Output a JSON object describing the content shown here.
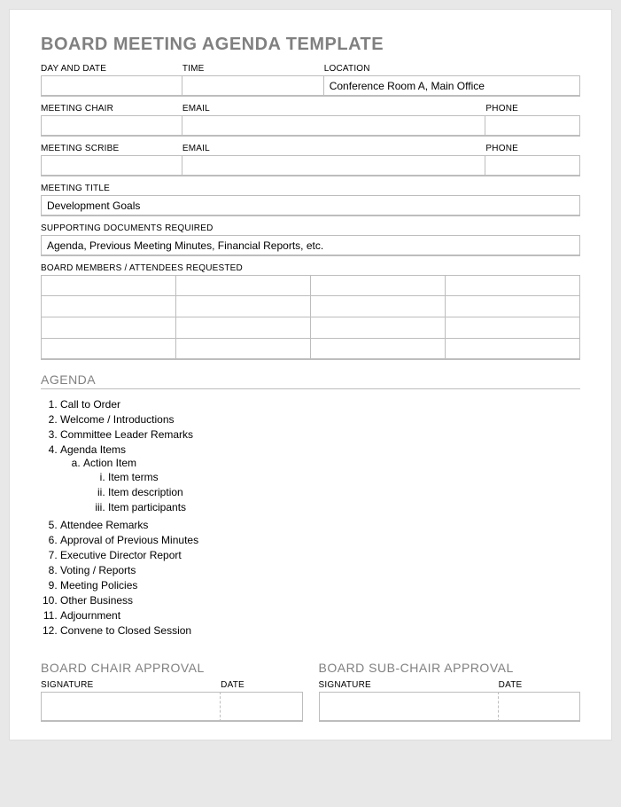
{
  "title": "BOARD MEETING AGENDA TEMPLATE",
  "meeting_info": {
    "day_date": {
      "label": "DAY AND DATE",
      "value": ""
    },
    "time": {
      "label": "TIME",
      "value": ""
    },
    "location": {
      "label": "LOCATION",
      "value": "Conference Room A, Main Office"
    }
  },
  "chair": {
    "name": {
      "label": "MEETING CHAIR",
      "value": ""
    },
    "email": {
      "label": "EMAIL",
      "value": ""
    },
    "phone": {
      "label": "PHONE",
      "value": ""
    }
  },
  "scribe": {
    "name": {
      "label": "MEETING SCRIBE",
      "value": ""
    },
    "email": {
      "label": "EMAIL",
      "value": ""
    },
    "phone": {
      "label": "PHONE",
      "value": ""
    }
  },
  "meeting_title": {
    "label": "MEETING TITLE",
    "value": "Development Goals"
  },
  "supporting_docs": {
    "label": "SUPPORTING DOCUMENTS REQUIRED",
    "value": "Agenda, Previous Meeting Minutes, Financial Reports, etc."
  },
  "attendees": {
    "label": "BOARD MEMBERS / ATTENDEES REQUESTED"
  },
  "agenda_heading": "AGENDA",
  "agenda": {
    "items": [
      "Call to Order",
      "Welcome / Introductions",
      "Committee Leader Remarks",
      "Agenda Items",
      "Attendee Remarks",
      "Approval of Previous Minutes",
      "Executive Director Report",
      "Voting / Reports",
      "Meeting Policies",
      "Other Business",
      "Adjournment",
      "Convene to Closed Session"
    ],
    "sub_a": "Action Item",
    "sub_i": [
      "Item terms",
      "Item description",
      "Item participants"
    ]
  },
  "approvals": {
    "chair": {
      "heading": "BOARD CHAIR APPROVAL",
      "signature_label": "SIGNATURE",
      "date_label": "DATE"
    },
    "subchair": {
      "heading": "BOARD SUB-CHAIR APPROVAL",
      "signature_label": "SIGNATURE",
      "date_label": "DATE"
    }
  }
}
